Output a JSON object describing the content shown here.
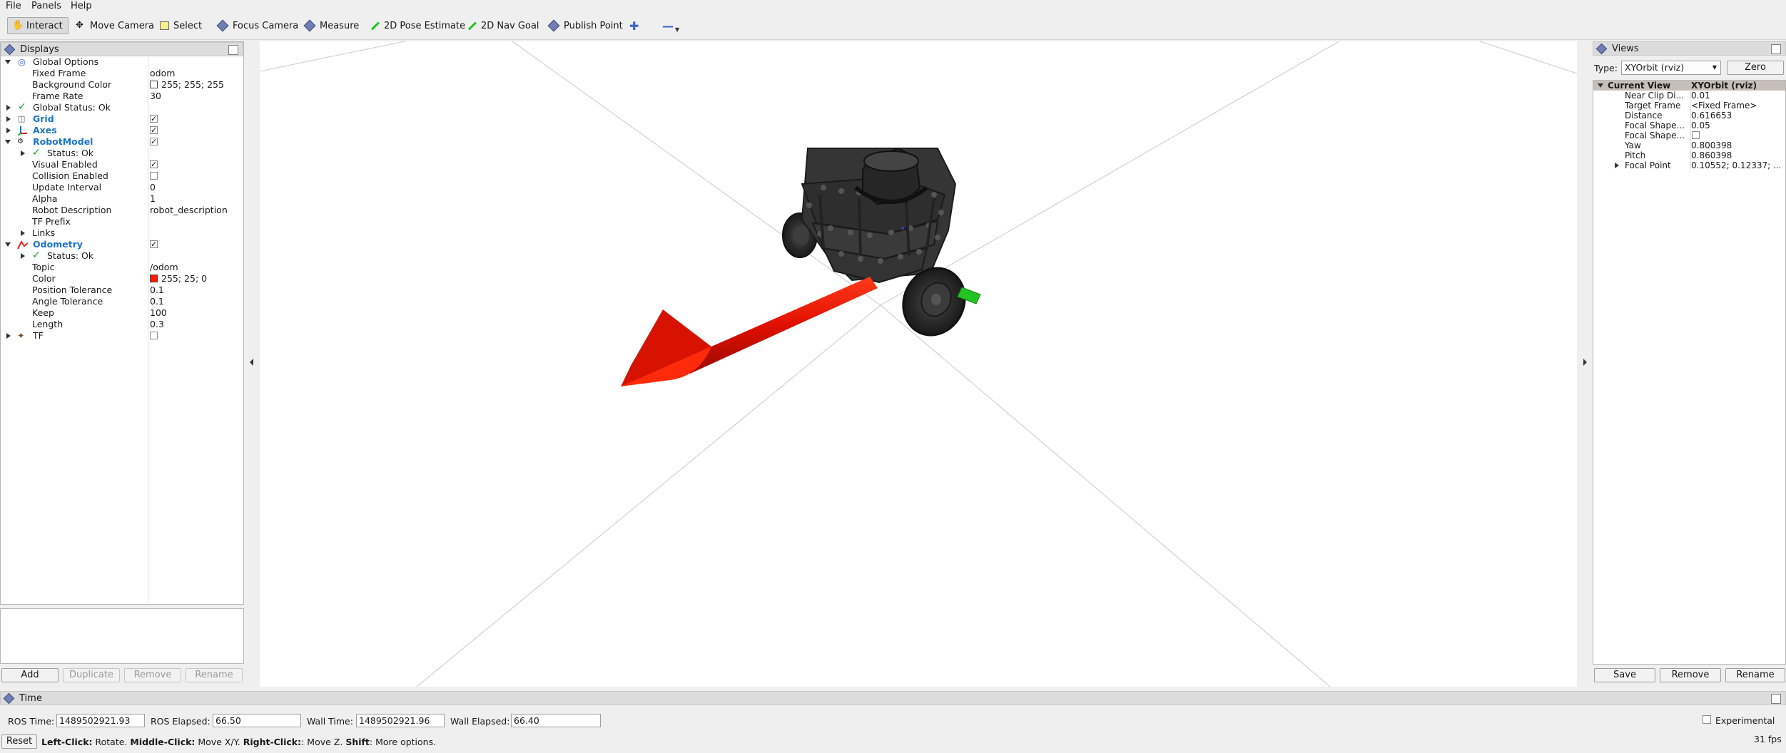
{
  "menu": {
    "file": "File",
    "panels": "Panels",
    "help": "Help"
  },
  "toolbar": {
    "interact": "Interact",
    "move_camera": "Move Camera",
    "select": "Select",
    "focus_camera": "Focus Camera",
    "measure": "Measure",
    "pose_estimate": "2D Pose Estimate",
    "nav_goal": "2D Nav Goal",
    "publish_point": "Publish Point"
  },
  "displays": {
    "title": "Displays",
    "global_options": "Global Options",
    "fixed_frame_label": "Fixed Frame",
    "fixed_frame": "odom",
    "background_color_label": "Background Color",
    "background_color": "255; 255; 255",
    "frame_rate_label": "Frame Rate",
    "frame_rate": "30",
    "global_status": "Global Status: Ok",
    "grid": "Grid",
    "axes": "Axes",
    "robot_model": "RobotModel",
    "rm_status": "Status: Ok",
    "visual_enabled_label": "Visual Enabled",
    "collision_enabled_label": "Collision Enabled",
    "update_interval_label": "Update Interval",
    "update_interval": "0",
    "alpha_label": "Alpha",
    "alpha": "1",
    "robot_description_label": "Robot Description",
    "robot_description": "robot_description",
    "tf_prefix_label": "TF Prefix",
    "links_label": "Links",
    "odometry": "Odometry",
    "odom_status": "Status: Ok",
    "topic_label": "Topic",
    "topic": "/odom",
    "color_label": "Color",
    "color": "255; 25; 0",
    "position_tolerance_label": "Position Tolerance",
    "position_tolerance": "0.1",
    "angle_tolerance_label": "Angle Tolerance",
    "angle_tolerance": "0.1",
    "keep_label": "Keep",
    "keep": "100",
    "length_label": "Length",
    "length": "0.3",
    "tf": "TF",
    "buttons": {
      "add": "Add",
      "duplicate": "Duplicate",
      "remove": "Remove",
      "rename": "Rename"
    }
  },
  "views": {
    "title": "Views",
    "type_label": "Type:",
    "type_value": "XYOrbit (rviz)",
    "zero": "Zero",
    "current_view": "Current View",
    "current_view_type": "XYOrbit (rviz)",
    "rows": [
      {
        "label": "Near Clip Di...",
        "value": "0.01"
      },
      {
        "label": "Target Frame",
        "value": "<Fixed Frame>"
      },
      {
        "label": "Distance",
        "value": "0.616653"
      },
      {
        "label": "Focal Shape...",
        "value": "0.05"
      },
      {
        "label": "Focal Shape...",
        "value": ""
      },
      {
        "label": "Yaw",
        "value": "0.800398"
      },
      {
        "label": "Pitch",
        "value": "0.860398"
      },
      {
        "label": "Focal Point",
        "value": "0.10552; 0.12337; ..."
      }
    ],
    "buttons": {
      "save": "Save",
      "remove": "Remove",
      "rename": "Rename"
    }
  },
  "time": {
    "title": "Time",
    "ros_time_label": "ROS Time:",
    "ros_time": "1489502921.93",
    "ros_elapsed_label": "ROS Elapsed:",
    "ros_elapsed": "66.50",
    "wall_time_label": "Wall Time:",
    "wall_time": "1489502921.96",
    "wall_elapsed_label": "Wall Elapsed:",
    "wall_elapsed": "66.40",
    "experimental": "Experimental"
  },
  "status": {
    "reset": "Reset",
    "left_click": "Left-Click:",
    "left_click_action": " Rotate. ",
    "middle_click": "Middle-Click:",
    "middle_click_action": " Move X/Y. ",
    "right_click": "Right-Click:",
    "right_click_action": ": Move Z. ",
    "shift": "Shift",
    "shift_action": ": More options.",
    "fps": "31 fps"
  },
  "colors": {
    "odometry_arrow": "#ff1900",
    "background": "#ffffff",
    "robot": "#3a3a3a"
  }
}
